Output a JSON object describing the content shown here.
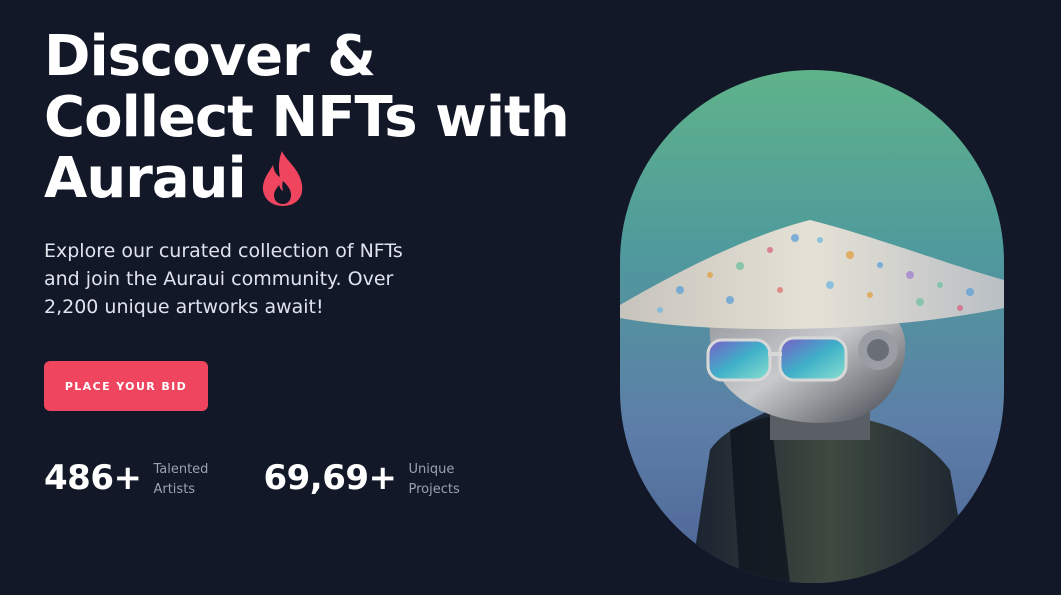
{
  "hero": {
    "title_line1": "Discover &",
    "title_line2": "Collect NFTs with",
    "title_line3": "Auraui",
    "subtitle": "Explore our curated collection of NFTs and join the Auraui community. Over 2,200 unique artworks await!",
    "cta_label": "PLACE YOUR BID"
  },
  "stats": [
    {
      "value": "486+",
      "label_line1": "Talented",
      "label_line2": "Artists"
    },
    {
      "value": "69,69+",
      "label_line1": "Unique",
      "label_line2": "Projects"
    }
  ],
  "icons": {
    "title_icon": "fire-icon"
  },
  "colors": {
    "background": "#121828",
    "accent": "#f0455f",
    "muted_text": "#9aa1b3"
  }
}
